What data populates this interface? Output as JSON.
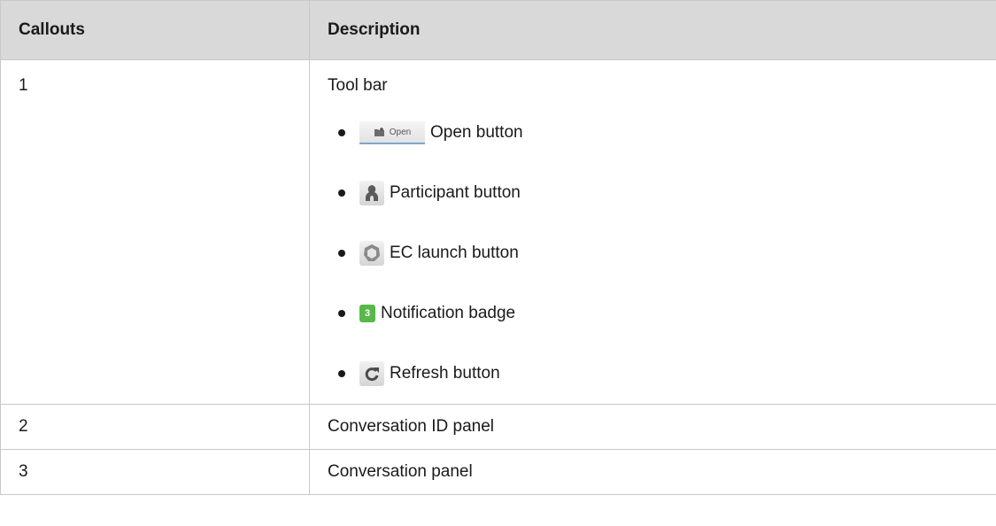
{
  "table": {
    "headers": [
      "Callouts",
      "Description"
    ],
    "rows": [
      {
        "callout": "1",
        "description": "Tool bar",
        "items": [
          {
            "icon": "open-button-icon",
            "icon_text": "Open",
            "label": "Open button"
          },
          {
            "icon": "participant-icon",
            "label": "Participant button"
          },
          {
            "icon": "ec-launch-icon",
            "label": "EC launch button"
          },
          {
            "icon": "notification-badge-icon",
            "icon_text": "3",
            "label": "Notification badge"
          },
          {
            "icon": "refresh-icon",
            "label": "Refresh button"
          }
        ]
      },
      {
        "callout": "2",
        "description": "Conversation ID panel"
      },
      {
        "callout": "3",
        "description": "Conversation panel"
      }
    ]
  },
  "colors": {
    "header_bg": "#d9d9d9",
    "border": "#c8c8c8",
    "badge_green": "#59b84a"
  }
}
